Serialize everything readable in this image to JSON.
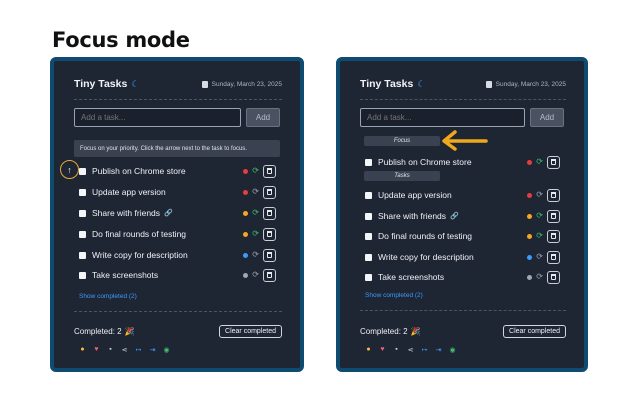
{
  "page": {
    "heading": "Focus mode"
  },
  "app": {
    "title": "Tiny Tasks",
    "date": "Sunday, March 23, 2025",
    "add_placeholder": "Add a task...",
    "add_label": "Add",
    "tooltip": "Focus on your priority. Click the arrow next to the task to focus.",
    "show_completed": "Show completed (2)",
    "completed_label": "Completed: 2",
    "clear_label": "Clear completed",
    "focus_label": "Focus",
    "tasks_label": "Tasks",
    "arrow_glyph": "↑",
    "party_glyph": "🎉"
  },
  "tasks": [
    {
      "text": "Publish on Chrome store",
      "priority_color": "#e53e3e",
      "has_link": false
    },
    {
      "text": "Update app version",
      "priority_color": "#e53e3e",
      "has_link": false
    },
    {
      "text": "Share with friends",
      "priority_color": "#f6a623",
      "has_link": true
    },
    {
      "text": "Do final rounds of testing",
      "priority_color": "#f6a623",
      "has_link": false
    },
    {
      "text": "Write copy for description",
      "priority_color": "#3b9bff",
      "has_link": false
    },
    {
      "text": "Take screenshots",
      "priority_color": "#a0a7b4",
      "has_link": false
    }
  ],
  "footer_icons": [
    {
      "name": "chat-icon",
      "color": "#f6c23e"
    },
    {
      "name": "heart-icon",
      "color": "#f25f7a"
    },
    {
      "name": "folder-icon",
      "color": "#cfd4dd"
    },
    {
      "name": "share-icon",
      "color": "#cfd4dd"
    },
    {
      "name": "export-icon",
      "color": "#3b9bff"
    },
    {
      "name": "import-icon",
      "color": "#3b9bff"
    },
    {
      "name": "eye-icon",
      "color": "#3fbf6f"
    }
  ],
  "colors": {
    "accent": "#3b9bff",
    "frame_border": "#0f4a70",
    "panel": "#1e2533",
    "annotation_arrow": "#f0a81c"
  }
}
